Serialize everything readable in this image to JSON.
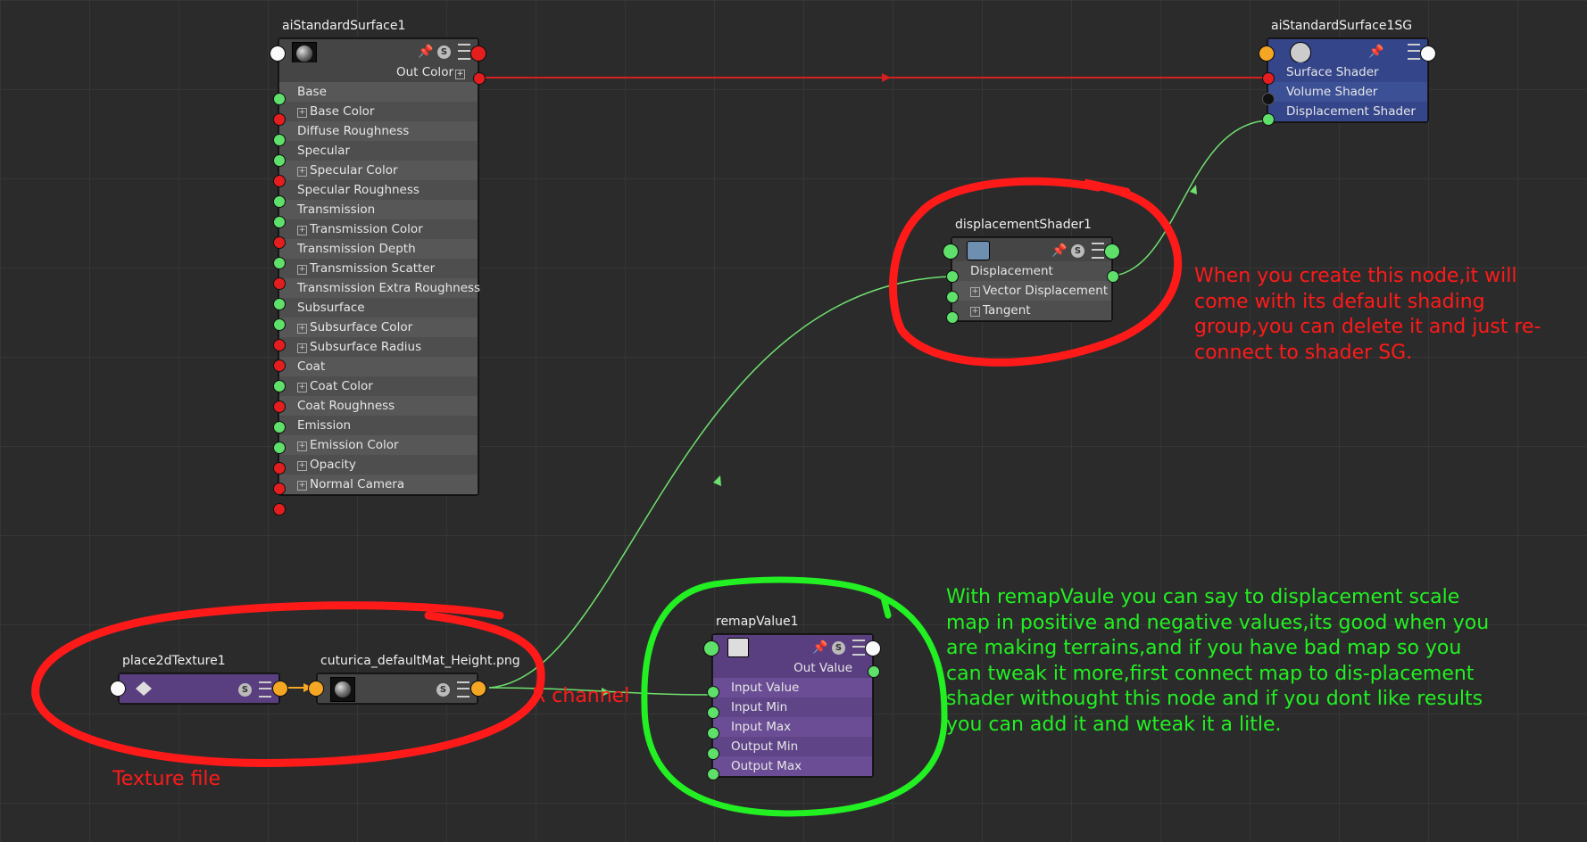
{
  "nodes": {
    "ai_standard_surface": {
      "title": "aiStandardSurface1",
      "output_label": "Out Color",
      "attributes": [
        {
          "label": "Base",
          "expandable": false
        },
        {
          "label": "Base Color",
          "expandable": true
        },
        {
          "label": "Diffuse Roughness",
          "expandable": false
        },
        {
          "label": "Specular",
          "expandable": false
        },
        {
          "label": "Specular Color",
          "expandable": true
        },
        {
          "label": "Specular Roughness",
          "expandable": false
        },
        {
          "label": "Transmission",
          "expandable": false
        },
        {
          "label": "Transmission Color",
          "expandable": true
        },
        {
          "label": "Transmission Depth",
          "expandable": false
        },
        {
          "label": "Transmission Scatter",
          "expandable": true
        },
        {
          "label": "Transmission Extra Roughness",
          "expandable": false
        },
        {
          "label": "Subsurface",
          "expandable": false
        },
        {
          "label": "Subsurface Color",
          "expandable": true
        },
        {
          "label": "Subsurface Radius",
          "expandable": true
        },
        {
          "label": "Coat",
          "expandable": false
        },
        {
          "label": "Coat Color",
          "expandable": true
        },
        {
          "label": "Coat Roughness",
          "expandable": false
        },
        {
          "label": "Emission",
          "expandable": false
        },
        {
          "label": "Emission Color",
          "expandable": true
        },
        {
          "label": "Opacity",
          "expandable": true
        },
        {
          "label": "Normal Camera",
          "expandable": true
        }
      ]
    },
    "shading_group": {
      "title": "aiStandardSurface1SG",
      "attributes": [
        "Surface Shader",
        "Volume Shader",
        "Displacement Shader"
      ]
    },
    "displacement_shader": {
      "title": "displacementShader1",
      "attributes": [
        {
          "label": "Displacement",
          "expandable": false
        },
        {
          "label": "Vector Displacement",
          "expandable": true
        },
        {
          "label": "Tangent",
          "expandable": true
        }
      ]
    },
    "place2d_texture": {
      "title": "place2dTexture1"
    },
    "file_texture": {
      "title": "cuturica_defaultMat_Height.png"
    },
    "remap_value": {
      "title": "remapValue1",
      "output_label": "Out Value",
      "attributes": [
        "Input Value",
        "Input Min",
        "Input Max",
        "Output Min",
        "Output Max"
      ]
    }
  },
  "annotations": {
    "displacement_note": "When you create this node,it will come with its default shading group,you can delete it and just re-connect to shader SG.",
    "remap_note": "With remapVaule you can say to displacement scale map in positive and negative values,its good when you are making terrains,and if you have bad map so you can tweak it more,first connect map to dis-placement shader withought this node and if you dont like results you can add it and wteak it a litle.",
    "r_channel": "R channel",
    "texture_file": "Texture file"
  },
  "colors": {
    "connection_red": "#d62020",
    "connection_green": "#6ee06e",
    "annotation_red": "#ff1a1a",
    "annotation_green": "#22f022",
    "sg_node_blue": "#34458a",
    "remap_node_purple": "#5a3f80"
  },
  "icons": {
    "pin": "pin-icon",
    "solo": "s-icon",
    "attributes": "attribute-list-icon"
  }
}
